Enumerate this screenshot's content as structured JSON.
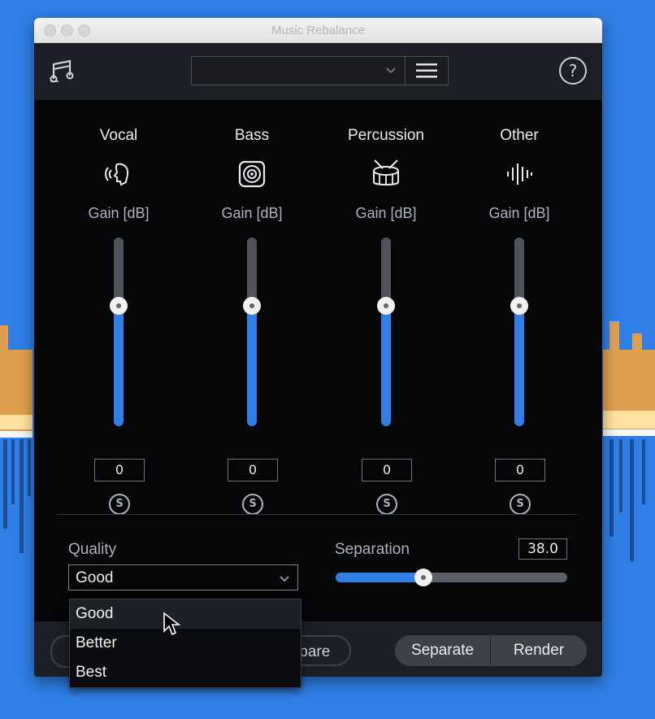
{
  "window": {
    "title": "Music Rebalance"
  },
  "toolbar": {
    "preset_value": "",
    "menu_icon": "hamburger-icon",
    "help_label": "?"
  },
  "channels": [
    {
      "name": "Vocal",
      "icon": "vocal-head-icon",
      "gain_label": "Gain [dB]",
      "value": "0",
      "solo_label": "S",
      "gain_fraction": 0.36
    },
    {
      "name": "Bass",
      "icon": "speaker-icon",
      "gain_label": "Gain [dB]",
      "value": "0",
      "solo_label": "S",
      "gain_fraction": 0.36
    },
    {
      "name": "Percussion",
      "icon": "drum-icon",
      "gain_label": "Gain [dB]",
      "value": "0",
      "solo_label": "S",
      "gain_fraction": 0.36
    },
    {
      "name": "Other",
      "icon": "waveform-icon",
      "gain_label": "Gain [dB]",
      "value": "0",
      "solo_label": "S",
      "gain_fraction": 0.36
    }
  ],
  "quality": {
    "label": "Quality",
    "selected": "Good",
    "options": [
      "Good",
      "Better",
      "Best"
    ],
    "highlighted": "Good"
  },
  "separation": {
    "label": "Separation",
    "value": "38.0",
    "fraction": 0.38
  },
  "footer": {
    "compare_label": "npare",
    "separate_label": "Separate",
    "render_label": "Render"
  },
  "colors": {
    "accent": "#2f7fe6",
    "panel": "#050608",
    "toolbar": "#1c1f25"
  }
}
